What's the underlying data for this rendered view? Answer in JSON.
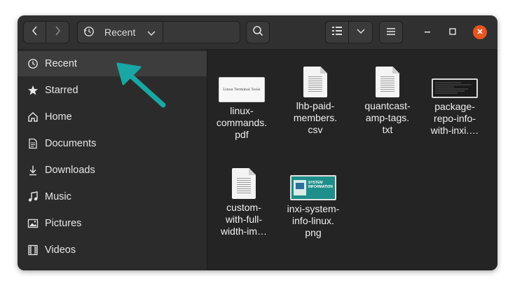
{
  "header": {
    "path_label": "Recent",
    "icons": {
      "back": "chevron-left-icon",
      "forward": "chevron-right-icon",
      "recent": "clock-history-icon",
      "dropdown": "chevron-down-icon",
      "search": "search-icon",
      "list_view": "list-view-icon",
      "menu": "hamburger-menu-icon",
      "minimize": "minimize-icon",
      "maximize": "maximize-icon",
      "close": "close-icon"
    }
  },
  "sidebar": {
    "items": [
      {
        "label": "Recent",
        "icon": "clock-history-icon",
        "active": true
      },
      {
        "label": "Starred",
        "icon": "star-icon"
      },
      {
        "label": "Home",
        "icon": "home-icon"
      },
      {
        "label": "Documents",
        "icon": "document-icon"
      },
      {
        "label": "Downloads",
        "icon": "download-icon"
      },
      {
        "label": "Music",
        "icon": "music-note-icon"
      },
      {
        "label": "Pictures",
        "icon": "picture-icon"
      },
      {
        "label": "Videos",
        "icon": "film-icon"
      }
    ]
  },
  "files": [
    {
      "name": "linux-commands.pdf",
      "display": "linux-\ncommands.\npdf",
      "type": "pdf-thumbnail",
      "thumb_text": "Linux Terminal Tools"
    },
    {
      "name": "lhb-paid-members.csv",
      "display": "lhb-paid-\nmembers.\ncsv",
      "type": "text-document"
    },
    {
      "name": "quantcast-amp-tags.txt",
      "display": "quantcast-\namp-tags.\ntxt",
      "type": "text-document"
    },
    {
      "name": "package-repo-info-with-inxi",
      "display": "package-\nrepo-info-\nwith-inxi.…",
      "type": "terminal-screenshot"
    },
    {
      "name": "custom-with-full-width-im",
      "display": "custom-\nwith-full-\nwidth-im…",
      "type": "text-document"
    },
    {
      "name": "inxi-system-info-linux.png",
      "display": "inxi-system-\ninfo-linux.\npng",
      "type": "image-thumbnail",
      "thumb_text": "SYSTEM INFORMATION"
    }
  ],
  "annotation": {
    "arrow_color": "#19a7a5",
    "points_to": "sidebar-item-recent"
  },
  "colors": {
    "window_bg": "#2b2b2b",
    "content_bg": "#242424",
    "close_button": "#e95420",
    "active_row": "#3d3d3d"
  }
}
